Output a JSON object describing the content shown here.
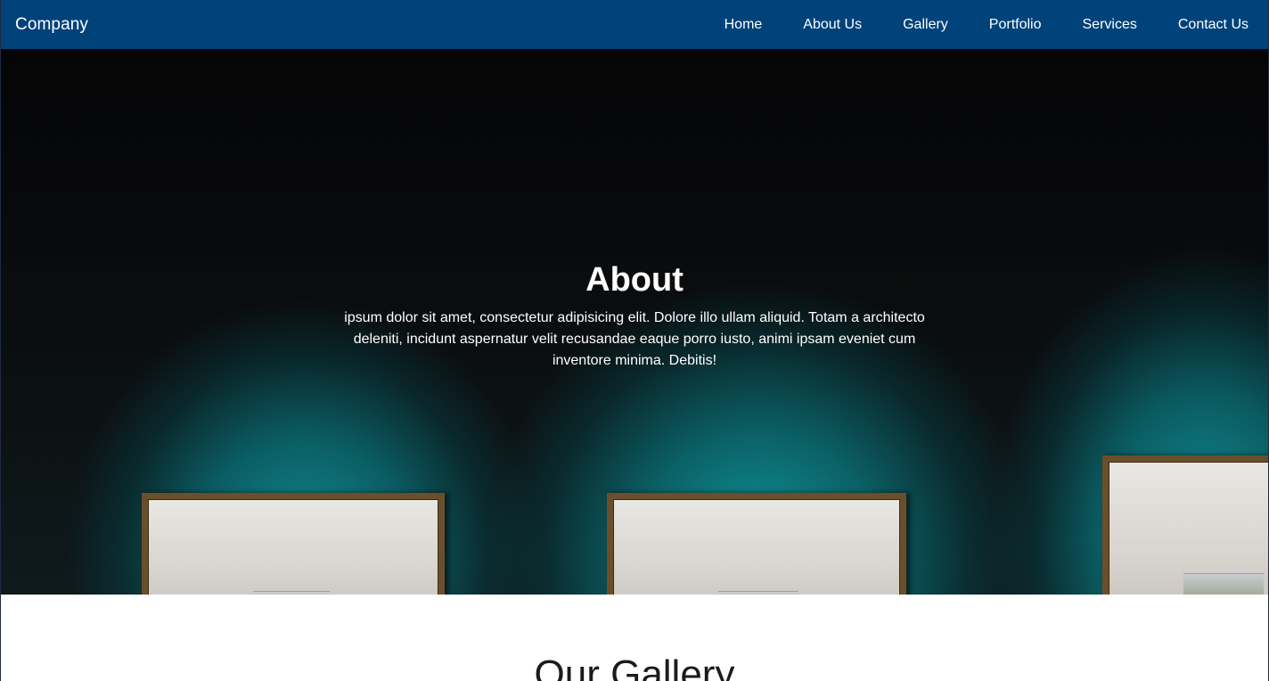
{
  "navbar": {
    "brand": "Company",
    "links": [
      "Home",
      "About Us",
      "Gallery",
      "Portfolio",
      "Services",
      "Contact Us"
    ],
    "background_color": "#00427a"
  },
  "hero": {
    "title": "About",
    "text": "ipsum dolor sit amet, consectetur adipisicing elit. Dolore illo ullam aliquid. Totam a architecto deleniti, incidunt aspernatur velit recusandae eaque porro iusto, animi ipsam eveniet cum inventore minima. Debitis!",
    "accent_color": "#0e9aa0"
  },
  "gallery": {
    "title": "Our Gallery"
  }
}
